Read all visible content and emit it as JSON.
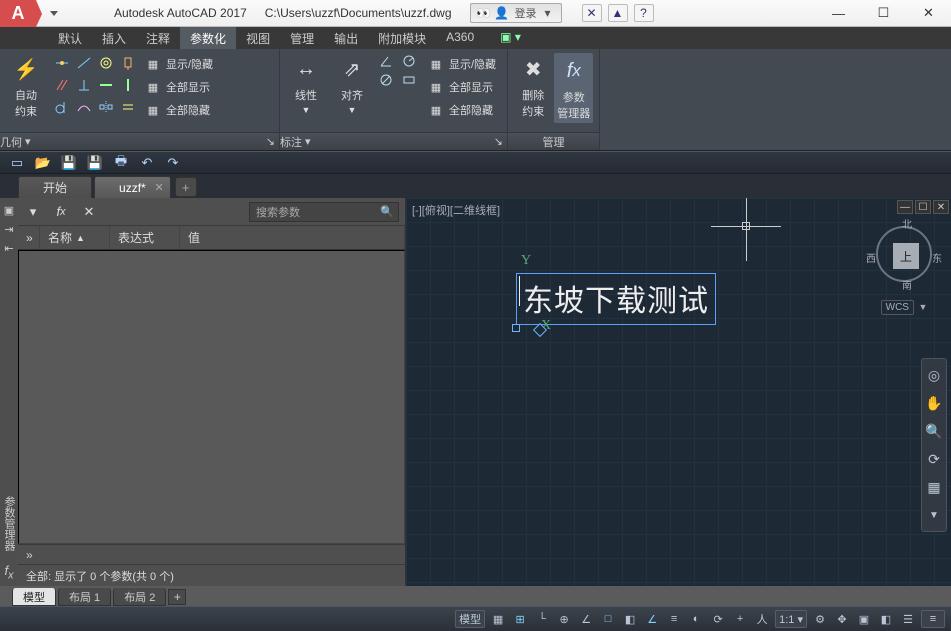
{
  "title": {
    "app": "Autodesk AutoCAD 2017",
    "path": "C:\\Users\\uzzf\\Documents\\uzzf.dwg",
    "login": "登录"
  },
  "menu": {
    "items": [
      "默认",
      "插入",
      "注释",
      "参数化",
      "视图",
      "管理",
      "输出",
      "附加模块",
      "A360"
    ],
    "active": 3
  },
  "ribbon": {
    "p1": {
      "title": "几何",
      "big": "自动\n约束",
      "rows": [
        "显示/隐藏",
        "全部显示",
        "全部隐藏"
      ]
    },
    "p2": {
      "title": "标注",
      "btns": [
        "线性",
        "对齐"
      ],
      "rows": [
        "显示/隐藏",
        "全部显示",
        "全部隐藏"
      ]
    },
    "p3": {
      "title": "管理",
      "btns": [
        "删除\n约束",
        "参数\n管理器"
      ]
    }
  },
  "filetabs": {
    "items": [
      "开始",
      "uzzf*"
    ],
    "active": 1
  },
  "params": {
    "search_ph": "搜索参数",
    "cols": {
      "c1": "名称",
      "c2": "表达式",
      "c3": "值"
    },
    "status": "全部: 显示了 0 个参数(共 0 个)"
  },
  "canvas": {
    "text": "东坡下载测试",
    "axis_x": "X",
    "axis_y": "Y"
  },
  "viewcube": {
    "face": "上",
    "n": "北",
    "s": "南",
    "e": "东",
    "w": "西",
    "wcs": "WCS"
  },
  "modeltabs": {
    "items": [
      "模型",
      "布局 1",
      "布局 2"
    ],
    "active": 0
  },
  "statusbar": {
    "model": "模型"
  }
}
